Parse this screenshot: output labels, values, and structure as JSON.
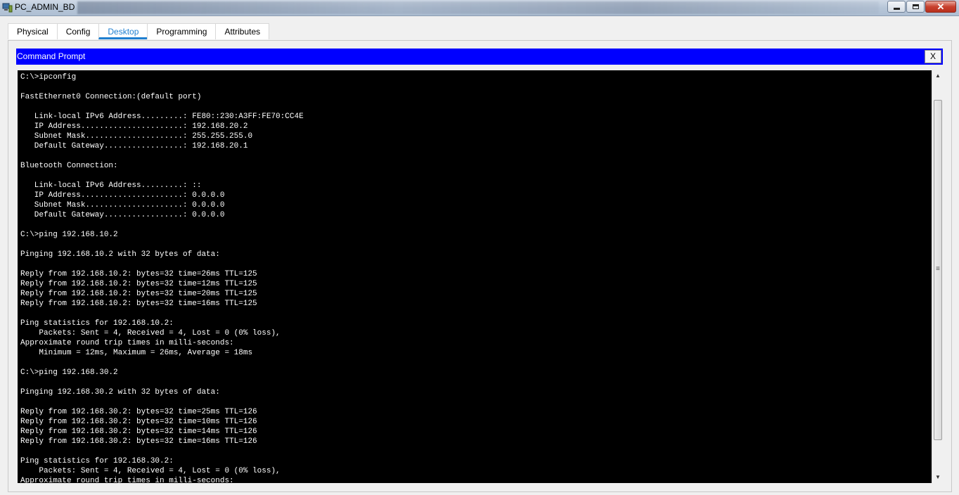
{
  "window": {
    "title": "PC_ADMIN_BD",
    "app_icon": "packet-tracer-pc-icon",
    "controls": {
      "minimize": "minimize-icon",
      "maximize": "restore-icon",
      "close": "✕"
    }
  },
  "tabs": [
    {
      "label": "Physical",
      "active": false
    },
    {
      "label": "Config",
      "active": false
    },
    {
      "label": "Desktop",
      "active": true
    },
    {
      "label": "Programming",
      "active": false
    },
    {
      "label": "Attributes",
      "active": false
    }
  ],
  "command_prompt": {
    "title": "Command Prompt",
    "close_label": "X",
    "lines": [
      "C:\\>ipconfig",
      "",
      "FastEthernet0 Connection:(default port)",
      "",
      "   Link-local IPv6 Address.........: FE80::230:A3FF:FE70:CC4E",
      "   IP Address......................: 192.168.20.2",
      "   Subnet Mask.....................: 255.255.255.0",
      "   Default Gateway.................: 192.168.20.1",
      "",
      "Bluetooth Connection:",
      "",
      "   Link-local IPv6 Address.........: ::",
      "   IP Address......................: 0.0.0.0",
      "   Subnet Mask.....................: 0.0.0.0",
      "   Default Gateway.................: 0.0.0.0",
      "",
      "C:\\>ping 192.168.10.2",
      "",
      "Pinging 192.168.10.2 with 32 bytes of data:",
      "",
      "Reply from 192.168.10.2: bytes=32 time=26ms TTL=125",
      "Reply from 192.168.10.2: bytes=32 time=12ms TTL=125",
      "Reply from 192.168.10.2: bytes=32 time=20ms TTL=125",
      "Reply from 192.168.10.2: bytes=32 time=16ms TTL=125",
      "",
      "Ping statistics for 192.168.10.2:",
      "    Packets: Sent = 4, Received = 4, Lost = 0 (0% loss),",
      "Approximate round trip times in milli-seconds:",
      "    Minimum = 12ms, Maximum = 26ms, Average = 18ms",
      "",
      "C:\\>ping 192.168.30.2",
      "",
      "Pinging 192.168.30.2 with 32 bytes of data:",
      "",
      "Reply from 192.168.30.2: bytes=32 time=25ms TTL=126",
      "Reply from 192.168.30.2: bytes=32 time=10ms TTL=126",
      "Reply from 192.168.30.2: bytes=32 time=14ms TTL=126",
      "Reply from 192.168.30.2: bytes=32 time=16ms TTL=126",
      "",
      "Ping statistics for 192.168.30.2:",
      "    Packets: Sent = 4, Received = 4, Lost = 0 (0% loss),",
      "Approximate round trip times in milli-seconds:"
    ]
  },
  "scrollbar": {
    "up_icon": "▲",
    "down_icon": "▼",
    "grip_icon": "≡"
  },
  "colors": {
    "accent_tab": "#1f7fd0",
    "cmd_header": "#0000ff",
    "terminal_bg": "#000000",
    "terminal_fg": "#ffffff"
  }
}
